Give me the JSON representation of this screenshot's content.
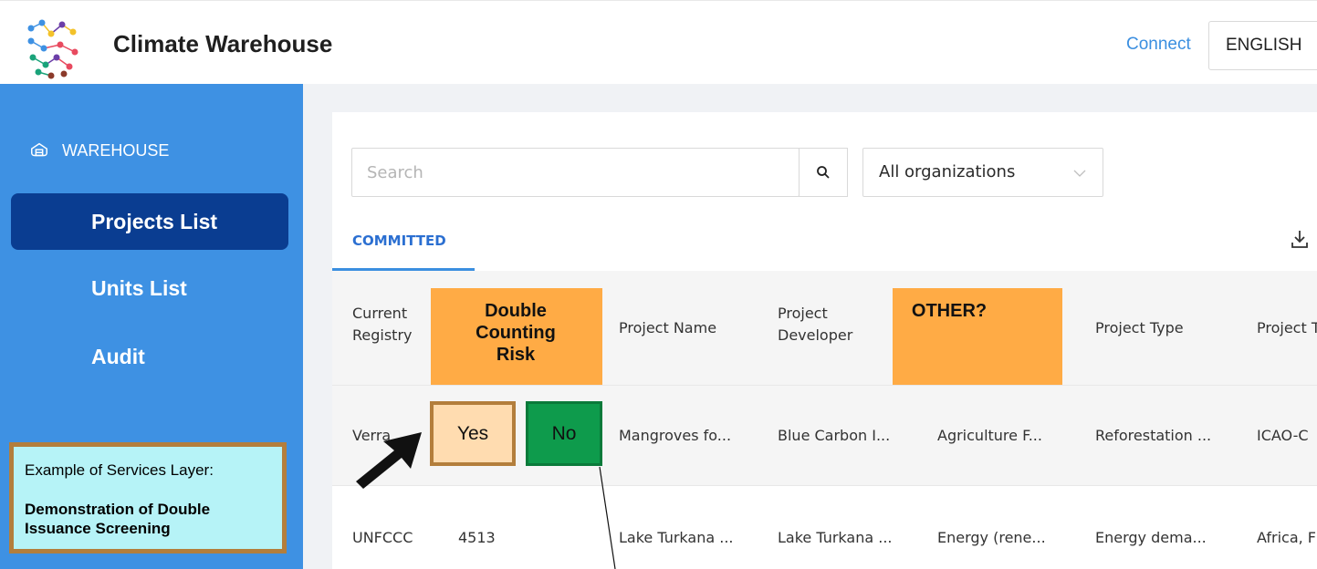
{
  "header": {
    "app_title": "Climate Warehouse",
    "connect_label": "Connect",
    "language": "ENGLISH"
  },
  "sidebar": {
    "section_label": "WAREHOUSE",
    "items": [
      {
        "label": "Projects List",
        "active": true
      },
      {
        "label": "Units List",
        "active": false
      },
      {
        "label": "Audit",
        "active": false
      }
    ],
    "note": {
      "line1": "Example of Services Layer:",
      "line2": "Demonstration of Double Issuance Screening"
    }
  },
  "filters": {
    "search_placeholder": "Search",
    "organization": "All organizations"
  },
  "tabs": {
    "committed": "COMMITTED"
  },
  "table": {
    "headers": {
      "current_registry": "Current Registry",
      "double_counting_risk": "Double Counting Risk",
      "project_name": "Project Name",
      "project_developer": "Project Developer",
      "other": "OTHER?",
      "project_type": "Project Type",
      "project_tags": "Project T"
    },
    "rows": [
      {
        "registry": "Verra",
        "yes_label": "Yes",
        "no_label": "No",
        "project_name": "Mangroves fo...",
        "developer": "Blue Carbon I...",
        "sector": "Agriculture F...",
        "type": "Reforestation ...",
        "tags": "ICAO-C"
      },
      {
        "registry": "UNFCCC",
        "id": "4513",
        "project_name": "Lake Turkana ...",
        "developer": "Lake Turkana ...",
        "sector": "Energy (rene...",
        "type": "Energy dema...",
        "tags": "Africa, F"
      }
    ]
  },
  "colors": {
    "sidebar_bg": "#3e91e3",
    "sidebar_active": "#0a3d91",
    "accent": "#3b8fe0",
    "highlight_orange": "#ffab45",
    "yes_bg": "#ffdcb0",
    "no_bg": "#0e9b4c",
    "note_bg": "#b6f3f7"
  }
}
